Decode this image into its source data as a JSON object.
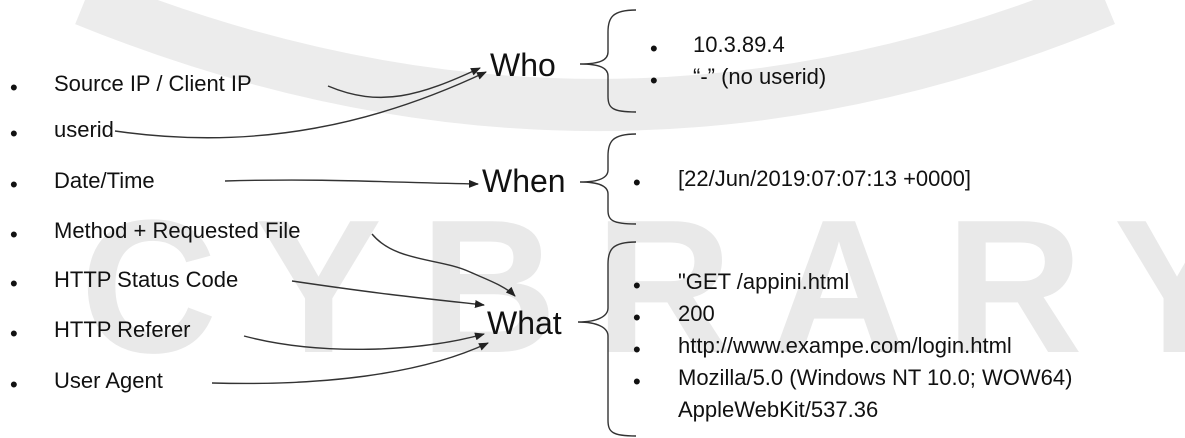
{
  "watermark": {
    "text": "CYBRARY"
  },
  "fields": [
    {
      "label": "Source IP / Client IP"
    },
    {
      "label": "userid"
    },
    {
      "label": "Date/Time"
    },
    {
      "label": "Method + Requested File"
    },
    {
      "label": "HTTP Status Code"
    },
    {
      "label": "HTTP Referer"
    },
    {
      "label": "User Agent"
    }
  ],
  "categories": {
    "who": "Who",
    "when": "When",
    "what": "What"
  },
  "values": {
    "who": [
      "10.3.89.4",
      "“-” (no userid)"
    ],
    "when": [
      "[22/Jun/2019:07:07:13 +0000]"
    ],
    "what": [
      "\"GET /appini.html",
      "200",
      "http://www.exampe.com/login.html",
      "Mozilla/5.0 (Windows NT 10.0; WOW64)",
      "AppleWebKit/537.36"
    ]
  },
  "bullet_glyph": "•",
  "colors": {
    "text": "#111111",
    "watermark": "#e9e9e9",
    "lines": "#333333"
  }
}
